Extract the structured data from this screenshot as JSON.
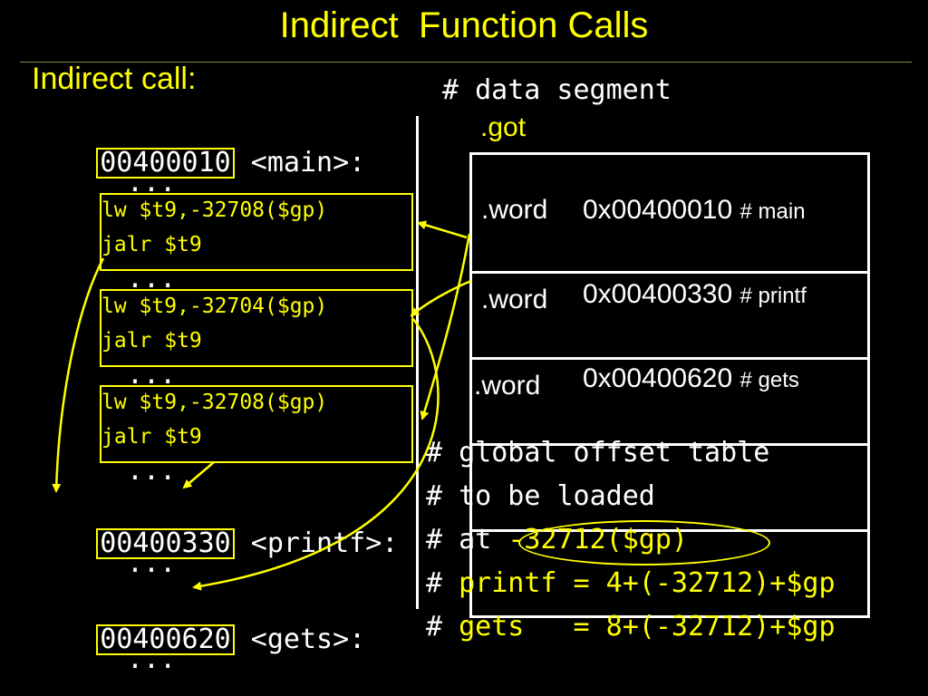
{
  "title": "Indirect  Function Calls",
  "left": {
    "heading": "Indirect call:",
    "main": {
      "addr": "00400010",
      "label": " <main>:"
    },
    "dots": "...",
    "blocks": [
      {
        "line1": "lw $t9,-32708($gp)",
        "line2": "jalr $t9"
      },
      {
        "line1": "lw $t9,-32704($gp)",
        "line2": "jalr $t9"
      },
      {
        "line1": "lw $t9,-32708($gp)",
        "line2": "jalr $t9"
      }
    ],
    "printf": {
      "addr": "00400330",
      "label": " <printf>:"
    },
    "gets": {
      "addr": "00400620",
      "label": " <gets>:"
    }
  },
  "right": {
    "data_segment": "# data segment",
    "got_label": ".got",
    "rows": [
      {
        "word": ".word",
        "value": "0x00400010",
        "comment": "# main"
      },
      {
        "word": ".word",
        "value": "0x00400330",
        "comment": "# printf"
      },
      {
        "word": ".word",
        "value": "0x00400620",
        "comment": "# gets"
      },
      {
        "word": "",
        "value": "",
        "comment": ""
      },
      {
        "word": "",
        "value": "",
        "comment": ""
      }
    ],
    "notes": {
      "hash": "#",
      "line1": "global offset table",
      "line2": "to be loaded",
      "line3_prefix": "at ",
      "line3_highlight": "-32712($gp)",
      "line4": "printf = 4+(-32712)+$gp",
      "line5": "gets   = 8+(-32712)+$gp"
    }
  },
  "colors": {
    "background": "#000000",
    "accent": "#ffff00",
    "text": "#ffffff"
  }
}
